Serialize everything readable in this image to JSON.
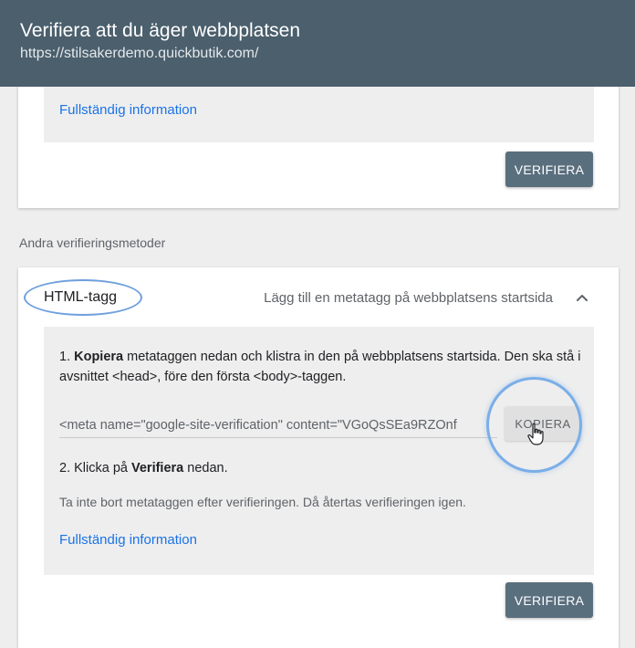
{
  "header": {
    "title": "Verifiera att du äger webbplatsen",
    "url": "https://stilsakerdemo.quickbutik.com/"
  },
  "first_method": {
    "info_link": "Fullständig information",
    "verify_label": "VERIFIERA"
  },
  "other_methods_label": "Andra verifieringsmetoder",
  "html_tag_method": {
    "title": "HTML-tagg",
    "description": "Lägg till en metatagg på webbplatsens startsida",
    "step1_prefix": "1. ",
    "step1_bold": "Kopiera",
    "step1_text": " metataggen nedan och klistra in den på webbplatsens startsida. Den ska stå i avsnittet <head>, före den första <body>-taggen.",
    "meta_code": "<meta name=\"google-site-verification\" content=\"VGoQsSEa9RZOnf",
    "copy_label": "KOPIERA",
    "step2_prefix": "2. Klicka på ",
    "step2_bold": "Verifiera",
    "step2_suffix": " nedan.",
    "note": "Ta inte bort metataggen efter verifieringen. Då återtas verifieringen igen.",
    "info_link": "Fullständig information",
    "verify_label": "VERIFIERA"
  },
  "colors": {
    "header_bg": "#4b5f6d",
    "button_bg": "#5a6f7e",
    "link": "#1a73e8",
    "highlight": "#7aaee8"
  },
  "icons": {
    "chevron": "chevron-up-icon",
    "cursor": "hand-pointer-cursor-icon"
  }
}
